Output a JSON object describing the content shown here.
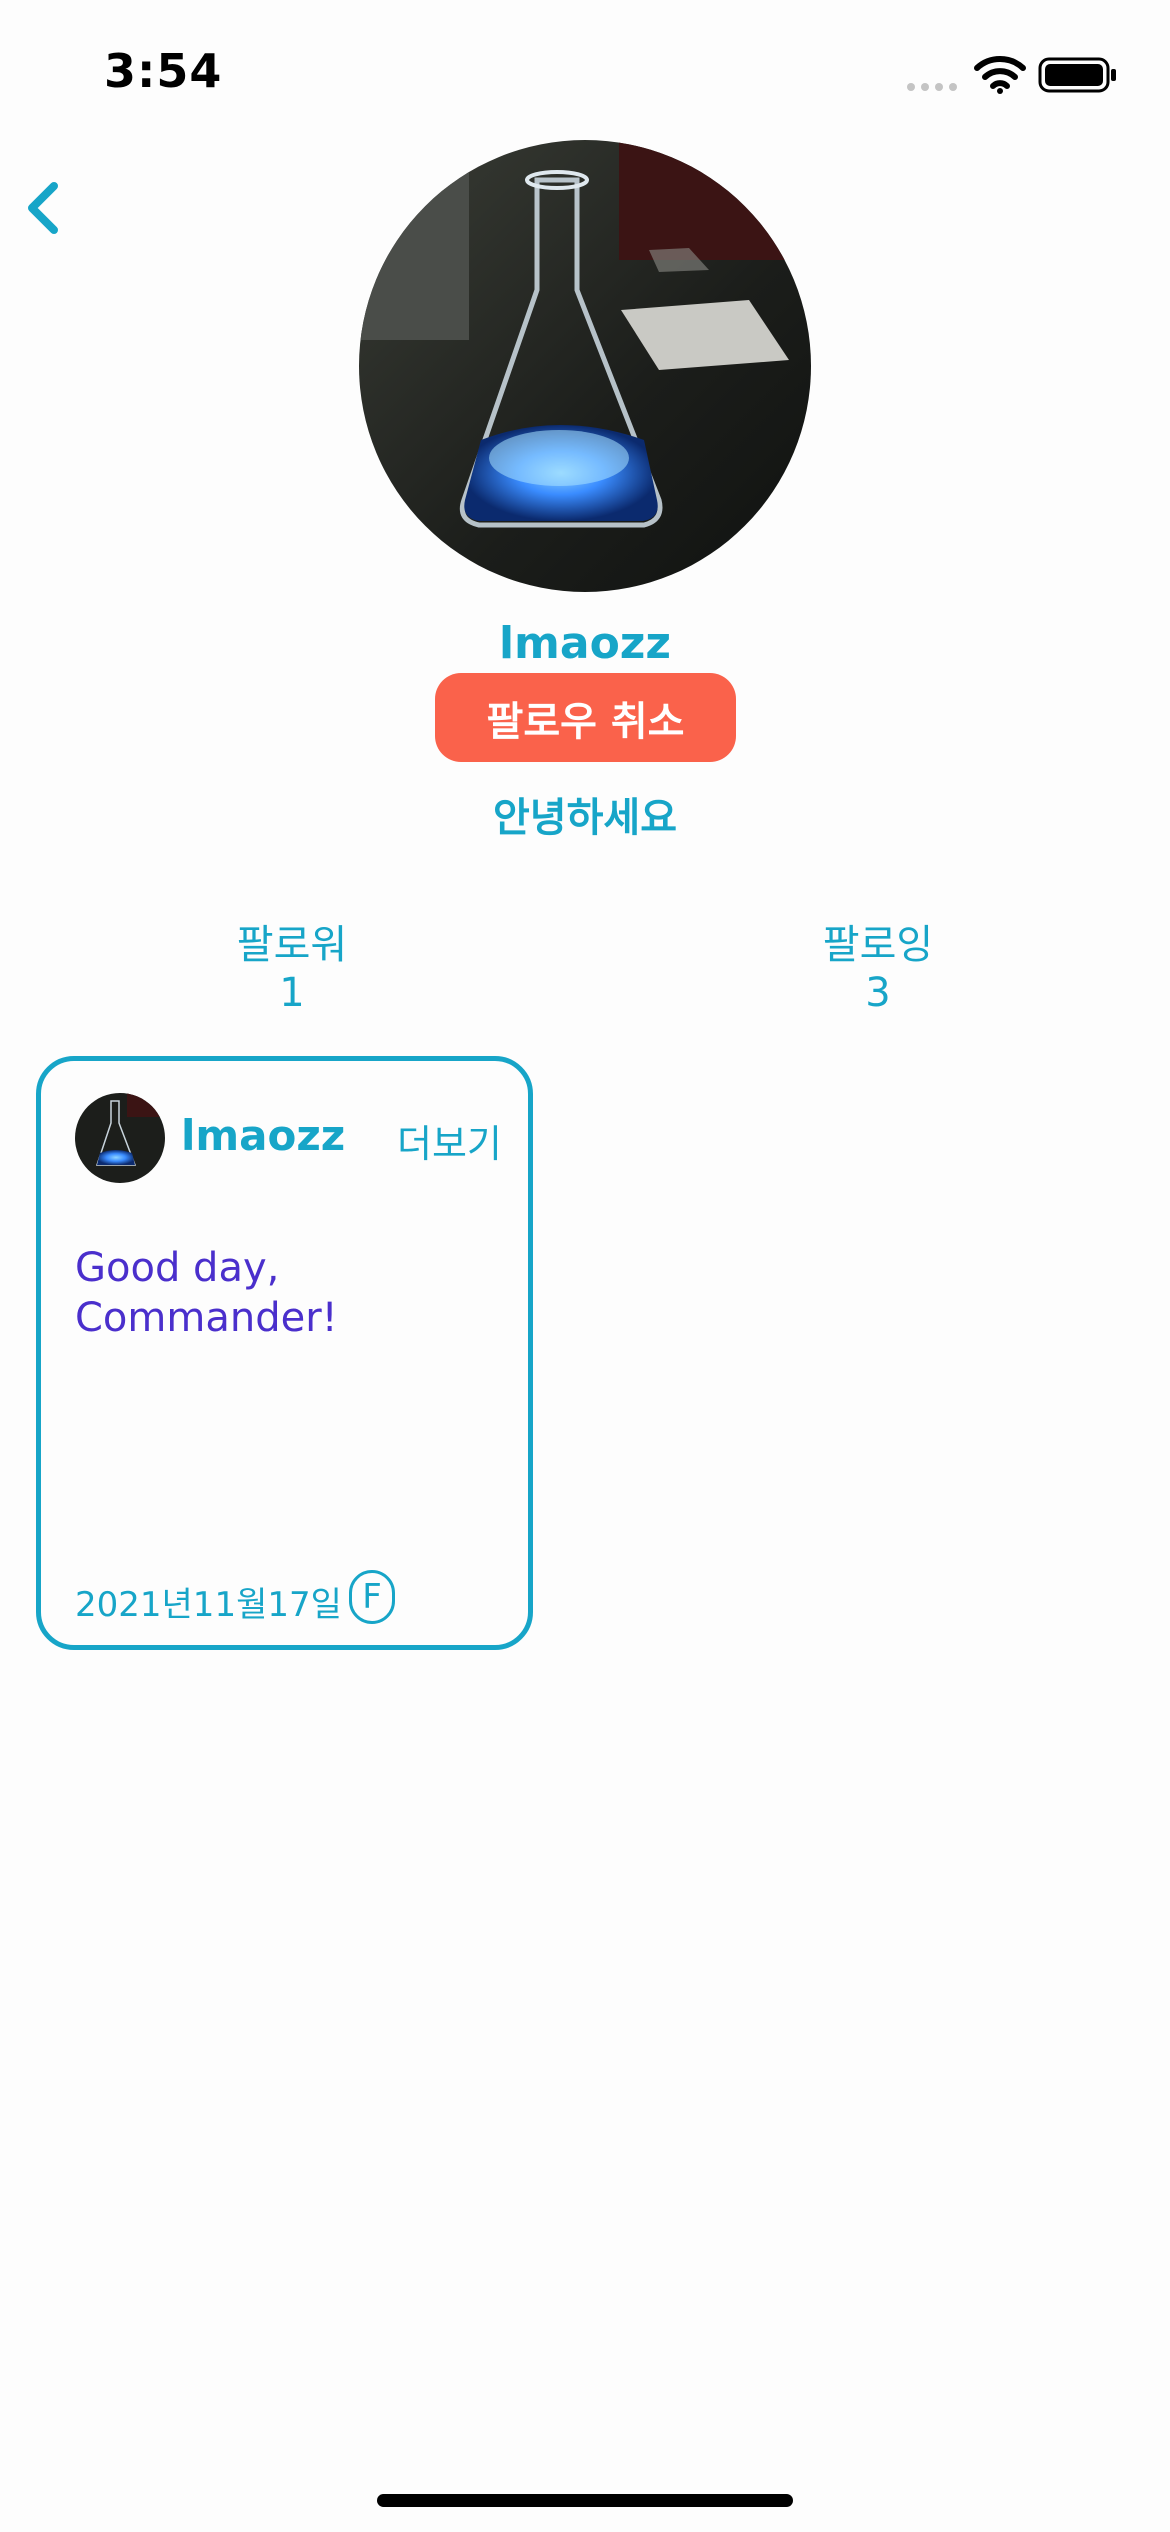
{
  "status_bar": {
    "time": "3:54"
  },
  "profile": {
    "name": "lmaozz",
    "unfollow_label": "팔로우 취소",
    "bio": "안녕하세요",
    "followers_label": "팔로워",
    "followers_count": "1",
    "following_label": "팔로잉",
    "following_count": "3"
  },
  "posts": [
    {
      "author": "lmaozz",
      "more_label": "더보기",
      "body": "Good day,\nCommander!",
      "date": "2021년11월17일",
      "badge": "F"
    }
  ],
  "icons": {
    "back": "chevron-left-icon",
    "wifi": "wifi-icon",
    "battery": "battery-icon",
    "signal": "signal-icon"
  },
  "colors": {
    "accent": "#17a5c8",
    "unfollow": "#fa624b",
    "post_text": "#4a2fcc"
  }
}
